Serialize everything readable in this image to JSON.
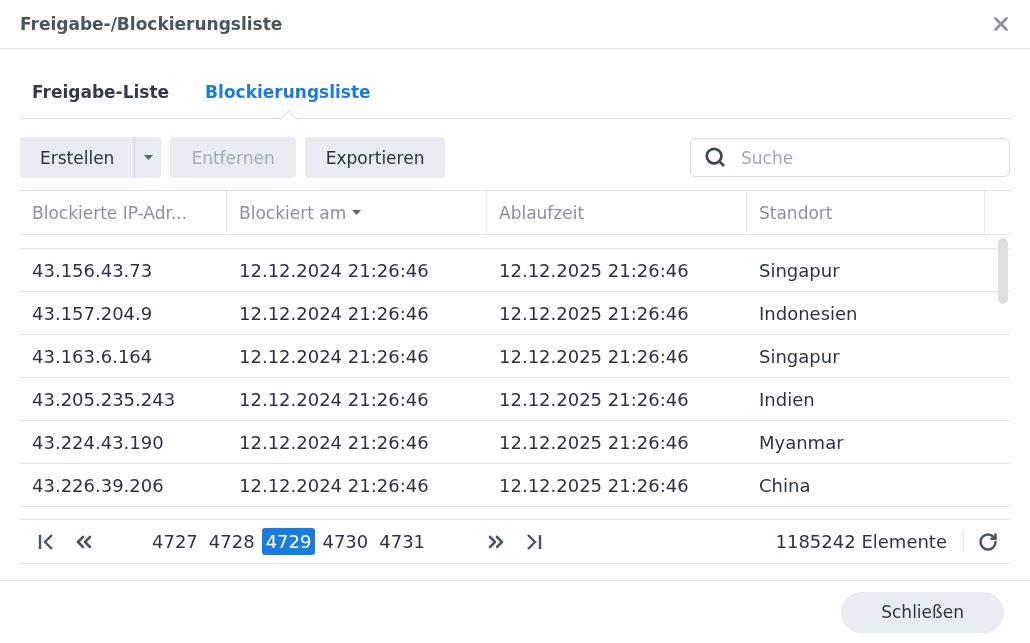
{
  "window": {
    "title": "Freigabe-/Blockierungsliste"
  },
  "tabs": [
    {
      "label": "Freigabe-Liste",
      "selected": false
    },
    {
      "label": "Blockierungsliste",
      "selected": true
    }
  ],
  "toolbar": {
    "buttons": [
      {
        "label": "Erstellen",
        "kind": "split",
        "disabled": false
      },
      {
        "label": "Entfernen",
        "kind": "plain",
        "disabled": true
      },
      {
        "label": "Exportieren",
        "kind": "plain",
        "disabled": false
      }
    ],
    "search": {
      "placeholder": "Suche"
    }
  },
  "table": {
    "columns": [
      {
        "label": "Blockierte IP-Adr...",
        "sorted": false
      },
      {
        "label": "Blockiert am",
        "sorted": true
      },
      {
        "label": "Ablaufzeit",
        "sorted": false
      },
      {
        "label": "Standort",
        "sorted": false
      }
    ],
    "rows": [
      [
        "43.156.43.73",
        "12.12.2024 21:26:46",
        "12.12.2025 21:26:46",
        "Singapur"
      ],
      [
        "43.157.204.9",
        "12.12.2024 21:26:46",
        "12.12.2025 21:26:46",
        "Indonesien"
      ],
      [
        "43.163.6.164",
        "12.12.2024 21:26:46",
        "12.12.2025 21:26:46",
        "Singapur"
      ],
      [
        "43.205.235.243",
        "12.12.2024 21:26:46",
        "12.12.2025 21:26:46",
        "Indien"
      ],
      [
        "43.224.43.190",
        "12.12.2024 21:26:46",
        "12.12.2025 21:26:46",
        "Myanmar"
      ],
      [
        "43.226.39.206",
        "12.12.2024 21:26:46",
        "12.12.2025 21:26:46",
        "China"
      ]
    ]
  },
  "pagination": {
    "pages": [
      {
        "label": "4727",
        "selected": false
      },
      {
        "label": "4728",
        "selected": false
      },
      {
        "label": "4729",
        "selected": true
      },
      {
        "label": "4730",
        "selected": false
      },
      {
        "label": "4731",
        "selected": false
      }
    ],
    "total": "1185242 Elemente"
  },
  "footer": {
    "close_button": "Schließen"
  }
}
